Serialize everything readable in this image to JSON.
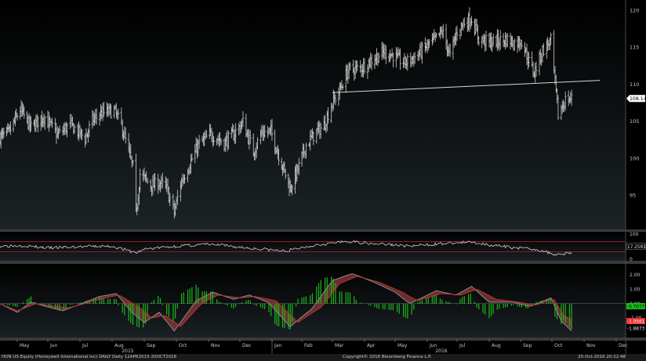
{
  "footer": {
    "left": "HON US Equity (Honeywell International Inc) DAILY  Daily 12APR2015-20OCT2016",
    "center": "Copyright© 2016 Bloomberg Finance L.P.",
    "right": "20-Oct-2016 20:22:48"
  },
  "colors": {
    "background": "#000000",
    "price_bars": "#d0d0d0",
    "trendline": "#d8d8d8",
    "rsi_line": "#d0d0d0",
    "rsi_bands": "#c02020",
    "macd_fast": "#8a8a8a",
    "macd_slow": "#c03030",
    "histogram": "#18b818",
    "last_price_label": "#ffffff",
    "macd_label": "#e83030",
    "rsi_label": "#18c018"
  },
  "chart_data": [
    {
      "type": "ohlc",
      "panel": "price",
      "ylim": [
        90.5,
        121
      ],
      "y_ticks": [
        95,
        100,
        105,
        110,
        115,
        120
      ],
      "last_price_label": "108.14",
      "trendline": {
        "from": [
          "2016-03-01",
          108.9
        ],
        "to": [
          "2016-10-20",
          110.6
        ]
      },
      "series": [
        {
          "points": [
            [
              "2015-04-13",
              102.9
            ],
            [
              "2015-04-22",
              103.4
            ],
            [
              "2015-05-04",
              106.6
            ],
            [
              "2015-05-15",
              104.2
            ],
            [
              "2015-05-28",
              105.7
            ],
            [
              "2015-06-10",
              103.2
            ],
            [
              "2015-06-22",
              104.6
            ],
            [
              "2015-07-06",
              102.7
            ],
            [
              "2015-07-13",
              105.1
            ],
            [
              "2015-07-21",
              106.1
            ],
            [
              "2015-08-03",
              106.5
            ],
            [
              "2015-08-10",
              104.5
            ],
            [
              "2015-08-21",
              98.8
            ],
            [
              "2015-08-24",
              92.5
            ],
            [
              "2015-08-28",
              97.9
            ],
            [
              "2015-09-08",
              96.3
            ],
            [
              "2015-09-15",
              96.8
            ],
            [
              "2015-09-22",
              95.9
            ],
            [
              "2015-09-29",
              92.7
            ],
            [
              "2015-10-05",
              96.6
            ],
            [
              "2015-10-15",
              99.6
            ],
            [
              "2015-10-22",
              101.8
            ],
            [
              "2015-11-03",
              103.3
            ],
            [
              "2015-11-16",
              102.1
            ],
            [
              "2015-11-25",
              103.3
            ],
            [
              "2015-12-04",
              104.9
            ],
            [
              "2015-12-14",
              100.9
            ],
            [
              "2015-12-22",
              103.5
            ],
            [
              "2015-12-31",
              103.6
            ],
            [
              "2016-01-11",
              99.3
            ],
            [
              "2016-01-20",
              95.9
            ],
            [
              "2016-01-29",
              98.9
            ],
            [
              "2016-02-05",
              101.8
            ],
            [
              "2016-02-12",
              103.1
            ],
            [
              "2016-02-22",
              104.5
            ],
            [
              "2016-03-01",
              107.5
            ],
            [
              "2016-03-07",
              108.9
            ],
            [
              "2016-03-16",
              111.9
            ],
            [
              "2016-03-29",
              112.3
            ],
            [
              "2016-04-08",
              113.3
            ],
            [
              "2016-04-20",
              114.4
            ],
            [
              "2016-04-29",
              113.9
            ],
            [
              "2016-05-10",
              112.9
            ],
            [
              "2016-05-20",
              113.7
            ],
            [
              "2016-06-01",
              115.2
            ],
            [
              "2016-06-10",
              116.2
            ],
            [
              "2016-06-16",
              117.2
            ],
            [
              "2016-06-24",
              113.9
            ],
            [
              "2016-07-01",
              117.2
            ],
            [
              "2016-07-08",
              118.4
            ],
            [
              "2016-07-15",
              118.9
            ],
            [
              "2016-07-22",
              116.2
            ],
            [
              "2016-08-01",
              115.7
            ],
            [
              "2016-08-10",
              115.9
            ],
            [
              "2016-08-19",
              116.1
            ],
            [
              "2016-08-26",
              115.6
            ],
            [
              "2016-09-02",
              115.9
            ],
            [
              "2016-09-09",
              113.1
            ],
            [
              "2016-09-14",
              111.6
            ],
            [
              "2016-09-22",
              114.6
            ],
            [
              "2016-09-30",
              115.9
            ],
            [
              "2016-10-07",
              105.9
            ],
            [
              "2016-10-14",
              107.9
            ],
            [
              "2016-10-20",
              108.1
            ]
          ]
        }
      ]
    },
    {
      "type": "line",
      "panel": "rsi",
      "ylim": [
        0,
        100
      ],
      "y_ticks": [
        0,
        50,
        100
      ],
      "bands": [
        30,
        70
      ],
      "last_value_label": "17.2581",
      "series": [
        {
          "points": [
            [
              "2015-04-13",
              52
            ],
            [
              "2015-05-05",
              55
            ],
            [
              "2015-06-01",
              45
            ],
            [
              "2015-07-01",
              50
            ],
            [
              "2015-08-01",
              52
            ],
            [
              "2015-08-24",
              25
            ],
            [
              "2015-09-01",
              40
            ],
            [
              "2015-10-01",
              52
            ],
            [
              "2015-11-01",
              60
            ],
            [
              "2015-12-01",
              48
            ],
            [
              "2016-01-15",
              32
            ],
            [
              "2016-02-15",
              58
            ],
            [
              "2016-03-15",
              70
            ],
            [
              "2016-04-15",
              62
            ],
            [
              "2016-05-15",
              52
            ],
            [
              "2016-06-15",
              62
            ],
            [
              "2016-07-15",
              68
            ],
            [
              "2016-08-15",
              50
            ],
            [
              "2016-09-15",
              40
            ],
            [
              "2016-10-05",
              19
            ],
            [
              "2016-10-20",
              26
            ]
          ]
        }
      ]
    },
    {
      "type": "line",
      "panel": "macd",
      "ylim": [
        -2.3,
        2.6
      ],
      "y_ticks": [
        -1,
        0,
        1,
        2
      ],
      "tick_labels": [
        "-1.00",
        "0.00",
        "1.00",
        "2.00"
      ],
      "value_labels": [
        "-0.7077",
        "-1.0561",
        "-1.8873"
      ],
      "series": [
        {
          "points": [
            [
              "2015-04-13",
              0.0
            ],
            [
              "2015-05-01",
              -0.6
            ],
            [
              "2015-05-15",
              0.1
            ],
            [
              "2015-06-15",
              -0.5
            ],
            [
              "2015-07-20",
              0.5
            ],
            [
              "2015-08-05",
              0.7
            ],
            [
              "2015-08-20",
              -0.6
            ],
            [
              "2015-09-01",
              -1.3
            ],
            [
              "2015-09-15",
              -0.6
            ],
            [
              "2015-09-29",
              -1.9
            ],
            [
              "2015-10-20",
              0.2
            ],
            [
              "2015-11-05",
              0.8
            ],
            [
              "2015-11-25",
              0.3
            ],
            [
              "2015-12-10",
              0.6
            ],
            [
              "2015-12-28",
              0.1
            ],
            [
              "2016-01-20",
              -1.6
            ],
            [
              "2016-02-10",
              -0.4
            ],
            [
              "2016-03-01",
              1.6
            ],
            [
              "2016-03-20",
              2.1
            ],
            [
              "2016-04-10",
              1.5
            ],
            [
              "2016-05-01",
              0.8
            ],
            [
              "2016-05-15",
              0.0
            ],
            [
              "2016-06-10",
              0.9
            ],
            [
              "2016-06-30",
              0.6
            ],
            [
              "2016-07-15",
              1.2
            ],
            [
              "2016-08-01",
              0.1
            ],
            [
              "2016-08-25",
              0.1
            ],
            [
              "2016-09-10",
              -0.2
            ],
            [
              "2016-09-30",
              0.4
            ],
            [
              "2016-10-10",
              -1.2
            ],
            [
              "2016-10-20",
              -1.9
            ]
          ]
        },
        {
          "points": [
            [
              "2015-04-13",
              0.0
            ],
            [
              "2015-05-01",
              -0.5
            ],
            [
              "2015-05-20",
              0.0
            ],
            [
              "2015-06-20",
              -0.3
            ],
            [
              "2015-07-25",
              0.4
            ],
            [
              "2015-08-08",
              0.6
            ],
            [
              "2015-08-28",
              -0.3
            ],
            [
              "2015-09-08",
              -1.0
            ],
            [
              "2015-09-20",
              -0.8
            ],
            [
              "2015-10-05",
              -1.6
            ],
            [
              "2015-10-25",
              0.0
            ],
            [
              "2015-11-10",
              0.6
            ],
            [
              "2015-12-01",
              0.4
            ],
            [
              "2015-12-15",
              0.5
            ],
            [
              "2016-01-05",
              0.2
            ],
            [
              "2016-01-28",
              -1.3
            ],
            [
              "2016-02-20",
              -0.2
            ],
            [
              "2016-03-08",
              1.4
            ],
            [
              "2016-03-25",
              1.9
            ],
            [
              "2016-04-15",
              1.5
            ],
            [
              "2016-05-08",
              0.8
            ],
            [
              "2016-05-22",
              0.2
            ],
            [
              "2016-06-15",
              0.7
            ],
            [
              "2016-07-05",
              0.6
            ],
            [
              "2016-07-20",
              1.0
            ],
            [
              "2016-08-08",
              0.3
            ],
            [
              "2016-08-30",
              0.1
            ],
            [
              "2016-09-15",
              -0.1
            ],
            [
              "2016-10-03",
              0.3
            ],
            [
              "2016-10-12",
              -0.8
            ],
            [
              "2016-10-20",
              -1.1
            ]
          ]
        }
      ]
    }
  ],
  "x_axis": {
    "months": [
      "May",
      "Jun",
      "Jul",
      "Aug",
      "Sep",
      "Oct",
      "Nov",
      "Dec",
      "Jan",
      "Feb",
      "Mar",
      "Apr",
      "May",
      "Jun",
      "Jul",
      "Aug",
      "Sep",
      "Oct",
      "Nov",
      "Dec"
    ],
    "years": [
      "2015",
      "2016"
    ]
  }
}
